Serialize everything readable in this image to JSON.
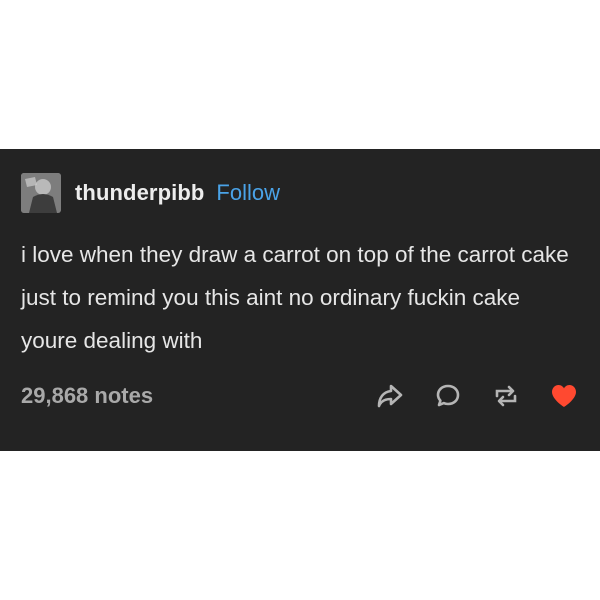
{
  "post": {
    "username": "thunderpibb",
    "follow_label": "Follow",
    "body": "i love when they draw a carrot on top of the carrot cake just to remind you this aint no ordinary fuckin cake youre dealing with",
    "notes_label": "29,868 notes"
  },
  "icons": {
    "avatar": "avatar-image",
    "share": "share-arrow-icon",
    "reply": "reply-bubble-icon",
    "reblog": "reblog-icon",
    "like": "heart-icon"
  },
  "colors": {
    "background": "#232323",
    "text": "#e6e6e6",
    "follow": "#4aa3e8",
    "notes": "#a9a9a9",
    "icon": "#b5b5b5",
    "like": "#ff4930"
  }
}
